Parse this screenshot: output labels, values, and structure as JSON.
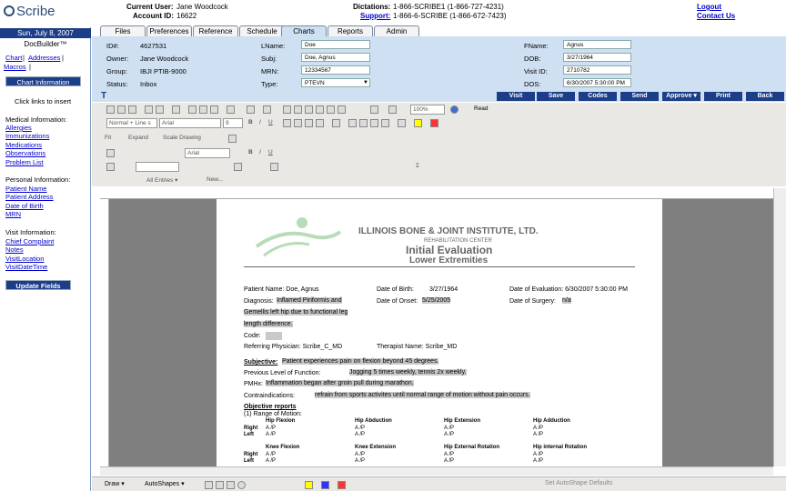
{
  "header": {
    "logo": "Scribe",
    "current_user_label": "Current User:",
    "current_user": "Jane Woodcock",
    "account_label": "Account ID:",
    "account_id": "16622",
    "dictations_label": "Dictations:",
    "dictations_phone": "1-866-SCRIBE1 (1-866-727-4231)",
    "support_label": "Support:",
    "support_phone": "1-866-6-SCRIBE (1-866-672-7423)",
    "logout": "Logout",
    "contact": "Contact Us"
  },
  "tabs": [
    "Files",
    "Preferences",
    "Reference",
    "Schedule",
    "Charts",
    "Reports",
    "Admin"
  ],
  "active_tab": "Charts",
  "left": {
    "date": "Sun, July 8, 2007",
    "docbuilder": "DocBuilder™",
    "links1": [
      "Chart",
      "Addresses",
      "Macros"
    ],
    "chart_info_btn": "Chart Information",
    "click_hint": "Click links to insert",
    "medical_heading": "Medical Information:",
    "medical_links": [
      "Allergies",
      "Immunizations",
      "Medications",
      "Observations",
      "Problem List"
    ],
    "personal_heading": "Personal Information:",
    "personal_links": [
      "Patient Name",
      "Patient Address",
      "Date of Birth",
      "MRN"
    ],
    "visit_heading": "Visit Information:",
    "visit_links": [
      "Chief Complaint",
      "Notes",
      "VisitLocation",
      "VisitDateTime"
    ],
    "update_btn": "Update Fields"
  },
  "patient": {
    "id_label": "ID#:",
    "id": "4627531",
    "owner_label": "Owner:",
    "owner": "Jane Woodcock",
    "group_label": "Group:",
    "group": "IBJI PTIB-9000",
    "status_label": "Status:",
    "status": "Inbox",
    "lname_label": "LName:",
    "lname": "Doe",
    "subj_label": "Subj:",
    "subj": "Doe, Agnus",
    "mrn_label": "MRN:",
    "mrn": "12334567",
    "type_label": "Type:",
    "type": "PTEVN",
    "fname_label": "FName:",
    "fname": "Agnus",
    "dob_label": "DOB:",
    "dob": "3/27/1964",
    "visit_label": "Visit ID:",
    "visit_id": "2710782",
    "dos_label": "DOS:",
    "dos": "6/30/2007 5:30:00 PM"
  },
  "actions": [
    "Visit",
    "Save",
    "Codes",
    "Send",
    "Approve ▾",
    "Print",
    "Back"
  ],
  "toolbar": {
    "zoom": "100%",
    "read": "Read",
    "style": "Normal + Line s",
    "font": "Arial",
    "size": "9",
    "fit": "Fit",
    "expand": "Expand",
    "scale": "Scale Drawing",
    "all_entries": "All Entries ▾",
    "new": "New..."
  },
  "doc": {
    "org": "ILLINOIS BONE & JOINT INSTITUTE, LTD.",
    "sub": "REHABILITATION CENTER",
    "title": "Initial Evaluation",
    "subtitle": "Lower Extremities",
    "patient_name": "Patient Name: Doe, Agnus",
    "dob": "Date of Birth:",
    "dob_val": "3/27/1964",
    "eval": "Date of Evaluation:  6/30/2007 5:30:00 PM",
    "diagnosis_label": "Diagnosis:",
    "diagnosis_1": "Inflamed Piriformis and",
    "diagnosis_2": "Gemellis left hip due to functional leg",
    "diagnosis_3": "length difference.",
    "onset_label": "Date of Onset:",
    "onset": "5/25/2005",
    "surgery_label": "Date of Surgery:",
    "surgery": "n/a",
    "code_label": "Code:",
    "ref_phys": "Referring Physician:  Scribe_C_MD",
    "therapist": "Therapist Name:  Scribe_MD",
    "subjective_label": "Subjective:",
    "subjective": "Patient experiences pain on flexion beyond 45 degrees.",
    "prev_label": "Previous Level of Function:",
    "prev": "Jogging 5 times weekly, tennis 2x weekly.",
    "pmhx_label": "PMHx:",
    "pmhx": "Inflammation began after groin pull during marathon.",
    "contra_label": "Contraindications:",
    "contra": "refrain from sports activites until normal range of motion without pain occurs.",
    "objective": "Objective reports",
    "rom": "(1)  Range of Motion:",
    "right": "Right",
    "left": "Left",
    "ap": "A /P",
    "col1": "Hip Flexion",
    "col2": "Hip Abduction",
    "col3": "Hip Extension",
    "col4": "Hip Adduction",
    "col5": "Knee Flexion",
    "col6": "Knee Extension",
    "col7": "Hip External Rotation",
    "col8": "Hip internal Rotation"
  },
  "drawbar": {
    "draw": "Draw ▾",
    "autoshapes": "AutoShapes ▾",
    "defaults": "Set AutoShape Defaults"
  }
}
